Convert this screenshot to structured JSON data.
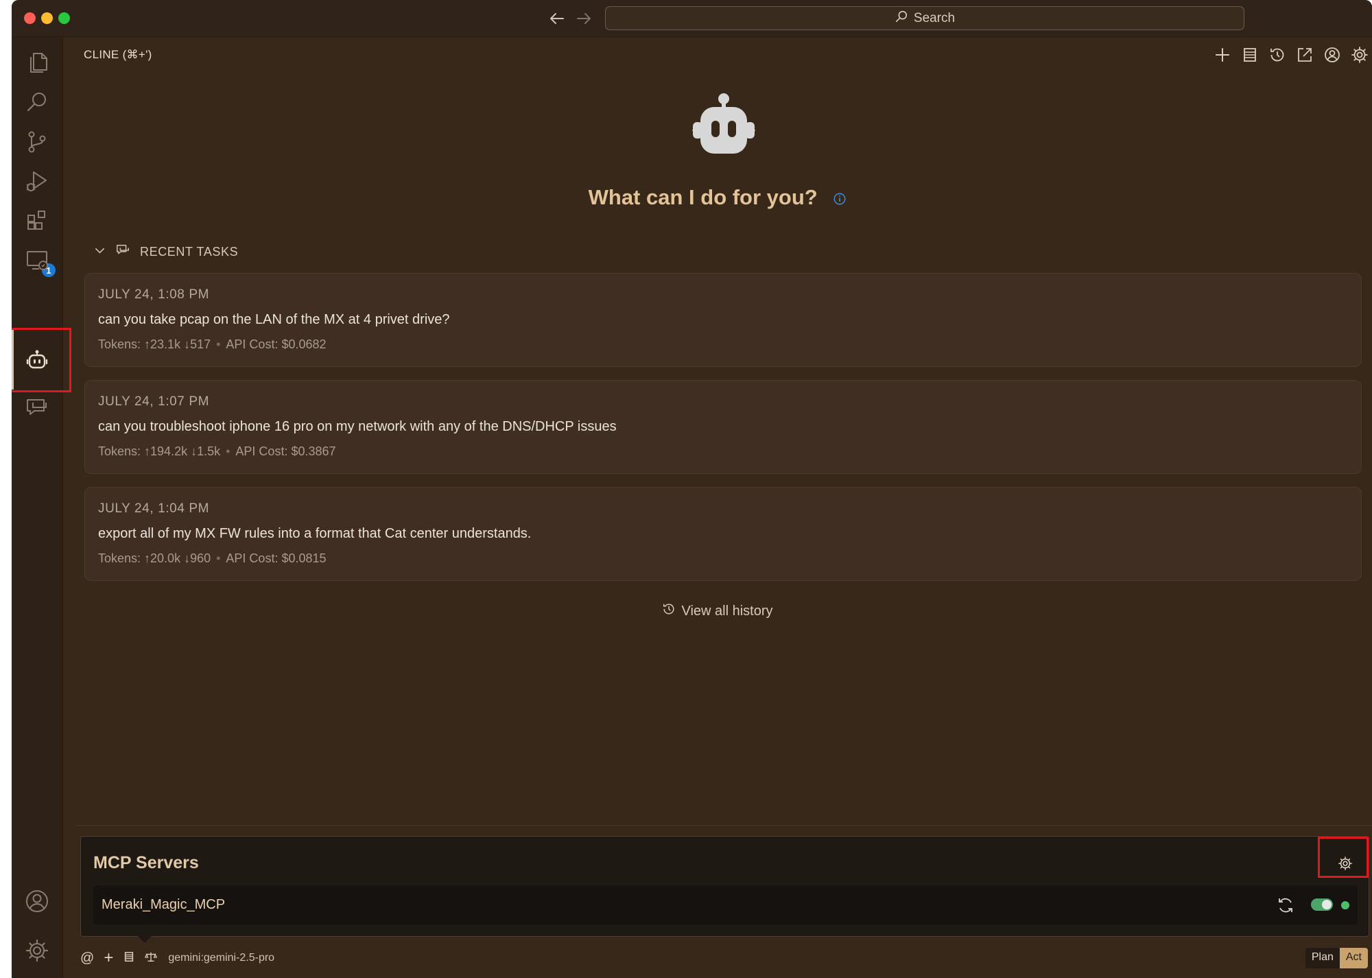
{
  "window": {
    "search_label": "Search"
  },
  "activity_bar": {
    "extensions_badge": "1"
  },
  "panel": {
    "title": "CLINE (⌘+')"
  },
  "hero": {
    "title": "What can I do for you?"
  },
  "recent_tasks": {
    "header": "RECENT TASKS",
    "items": [
      {
        "date": "JULY 24, 1:08 PM",
        "text": "can you take pcap on the LAN of the MX at 4 privet drive?",
        "tokens": "Tokens: ↑23.1k ↓517",
        "cost": "API Cost: $0.0682"
      },
      {
        "date": "JULY 24, 1:07 PM",
        "text": "can you troubleshoot iphone 16 pro on my network with any of the DNS/DHCP issues",
        "tokens": "Tokens: ↑194.2k ↓1.5k",
        "cost": "API Cost: $0.3867"
      },
      {
        "date": "JULY 24, 1:04 PM",
        "text": "export all of my MX FW rules into a format that Cat center understands.",
        "tokens": "Tokens: ↑20.0k ↓960",
        "cost": "API Cost: $0.0815"
      }
    ],
    "view_all_label": "View all history"
  },
  "mcp": {
    "title": "MCP Servers",
    "servers": [
      {
        "name": "Meraki_Magic_MCP"
      }
    ]
  },
  "bottom_bar": {
    "at_label": "@",
    "plus_label": "+",
    "model": "gemini:gemini-2.5-pro",
    "plan_label": "Plan",
    "act_label": "Act"
  },
  "colors": {
    "background": "#38281a",
    "accent": "#e3c398",
    "badge": "#1b7ad2",
    "highlight_box": "#e1181e",
    "toggle_on": "#4ea56c"
  }
}
